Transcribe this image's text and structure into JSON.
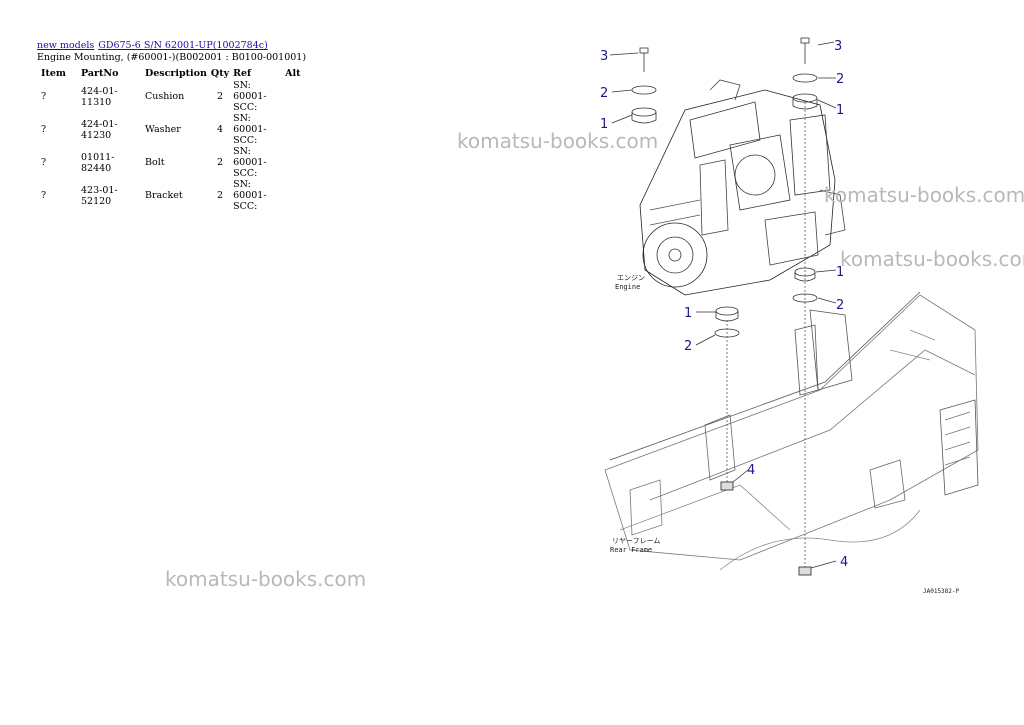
{
  "breadcrumb": {
    "link1": "new models",
    "link2": "GD675-6 S/N 62001-UP(1002784c)"
  },
  "page_title": "Engine Mounting, (#60001-)(B002001 : B0100-001001)",
  "table": {
    "headers": {
      "item": "Item",
      "partno": "PartNo",
      "description": "Description",
      "qty": "Qty",
      "ref": "Ref",
      "alt": "Alt"
    },
    "rows": [
      {
        "item": "?",
        "partno": "424-01-11310",
        "description": "Cushion",
        "qty": "2",
        "ref": "SN: 60001-SCC:",
        "alt": ""
      },
      {
        "item": "?",
        "partno": "424-01-41230",
        "description": "Washer",
        "qty": "4",
        "ref": "SN: 60001-SCC:",
        "alt": ""
      },
      {
        "item": "?",
        "partno": "01011-82440",
        "description": "Bolt",
        "qty": "2",
        "ref": "SN: 60001-SCC:",
        "alt": ""
      },
      {
        "item": "?",
        "partno": "423-01-52120",
        "description": "Bracket",
        "qty": "2",
        "ref": "SN: 60001-SCC:",
        "alt": ""
      }
    ]
  },
  "watermark_text": "komatsu-books.com",
  "diagram": {
    "callouts": [
      "3",
      "2",
      "1",
      "3",
      "2",
      "1",
      "1",
      "2",
      "1",
      "2",
      "4",
      "4"
    ],
    "engine_label_jp": "エンジン",
    "engine_label_en": "Engine",
    "frame_label_jp": "リヤーフレーム",
    "frame_label_en": "Rear Frame",
    "drawing_code": "JA015382-P"
  }
}
